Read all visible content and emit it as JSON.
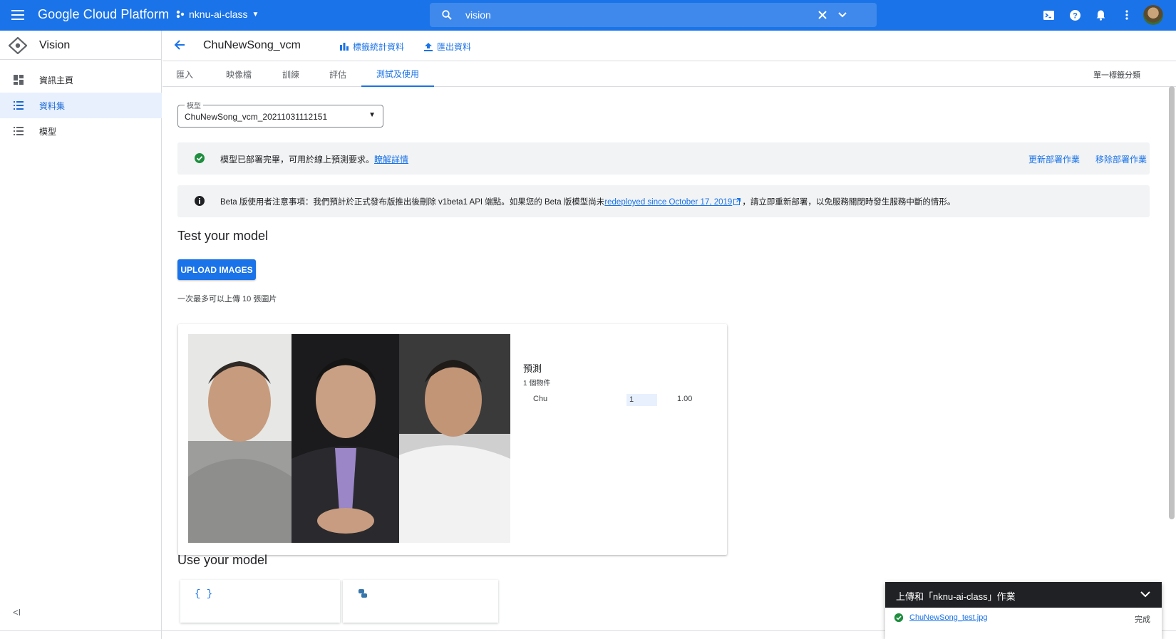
{
  "header": {
    "brand": "Google Cloud Platform",
    "project": "nknu-ai-class",
    "search_value": "vision"
  },
  "sidebar": {
    "title": "Vision",
    "items": [
      {
        "label": "資訊主頁"
      },
      {
        "label": "資料集"
      },
      {
        "label": "模型"
      }
    ]
  },
  "dataset": {
    "title": "ChuNewSong_vcm",
    "actions": {
      "label_stats": "標籤統計資料",
      "export": "匯出資料"
    }
  },
  "tabs": [
    {
      "label": "匯入"
    },
    {
      "label": "映像檔"
    },
    {
      "label": "訓練"
    },
    {
      "label": "評估"
    },
    {
      "label": "測試及使用"
    }
  ],
  "tab_right": "單一標籤分類",
  "model_select": {
    "label": "模型",
    "value": "ChuNewSong_vcm_20211031112151"
  },
  "deploy_banner": {
    "text": "模型已部署完畢，可用於線上預測要求。",
    "link": "瞭解詳情",
    "action_update": "更新部署作業",
    "action_remove": "移除部署作業"
  },
  "beta_banner": {
    "text_before": "Beta 版使用者注意事項：我們預計於正式發布版推出後刪除 v1beta1 API 端點。如果您的 Beta 版模型尚未",
    "link": "redeployed since October 17, 2019",
    "text_after": "，請立即重新部署，以免服務關閉時發生服務中斷的情形。"
  },
  "test": {
    "heading": "Test your model",
    "upload_label": "UPLOAD IMAGES",
    "hint": "一次最多可以上傳 10 張圖片"
  },
  "prediction": {
    "title": "預測",
    "count": "1 個物件",
    "rows": [
      {
        "label": "Chu",
        "bar": "1",
        "score": "1.00",
        "fraction": 1.0
      }
    ]
  },
  "use": {
    "heading": "Use your model"
  },
  "toast": {
    "title": "上傳和「nknu-ai-class」作業",
    "file": "ChuNewSong_test.jpg",
    "status": "完成"
  },
  "colors": {
    "primary": "#1a73e8",
    "success": "#1e8e3e",
    "topbar": "#1a73e8"
  }
}
